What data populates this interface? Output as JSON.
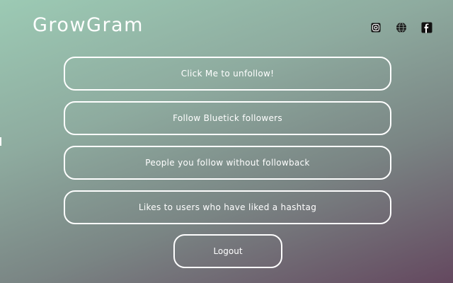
{
  "app": {
    "title": "GrowGram"
  },
  "header": {
    "icons": [
      {
        "name": "instagram-icon"
      },
      {
        "name": "globe-icon"
      },
      {
        "name": "facebook-icon"
      }
    ]
  },
  "menu": {
    "items": [
      {
        "label": "Click Me to unfollow!"
      },
      {
        "label": "Follow Bluetick followers"
      },
      {
        "label": "People you follow without followback"
      },
      {
        "label": "Likes to users who have liked a hashtag"
      }
    ],
    "logout_label": "Logout"
  },
  "colors": {
    "gradient_start": "#9ccab4",
    "gradient_end": "#64485f",
    "button_border": "#ffffff",
    "text": "#ffffff"
  }
}
